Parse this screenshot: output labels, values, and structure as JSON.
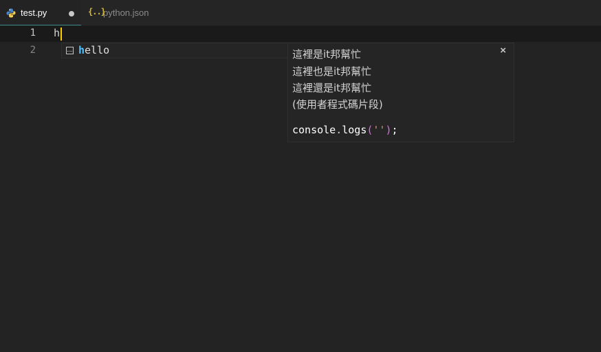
{
  "tabs": [
    {
      "label": "test.py",
      "icon": "python-icon",
      "dirty": true,
      "active": true
    },
    {
      "label": "python.json",
      "icon": "json-braces-icon",
      "active": false
    }
  ],
  "editor": {
    "lines": [
      {
        "number": "1",
        "text": "h"
      },
      {
        "number": "2",
        "text": ""
      }
    ]
  },
  "suggest": {
    "items": [
      {
        "kind": "snippet-icon",
        "match": "h",
        "rest": "ello"
      }
    ]
  },
  "details": {
    "description": [
      "這裡是it邦幫忙",
      "這裡也是it邦幫忙",
      "這裡還是it邦幫忙",
      "(使用者程式碼片段)"
    ],
    "code": {
      "ident": "console",
      "dot": ".",
      "method": "logs",
      "open": "(",
      "str": "''",
      "close": ")",
      "end": ";"
    },
    "close_label": "×"
  },
  "colors": {
    "background": "#232323",
    "accent": "#3c8e8a",
    "cursor": "#ffcc00",
    "match": "#4fc1ff"
  }
}
